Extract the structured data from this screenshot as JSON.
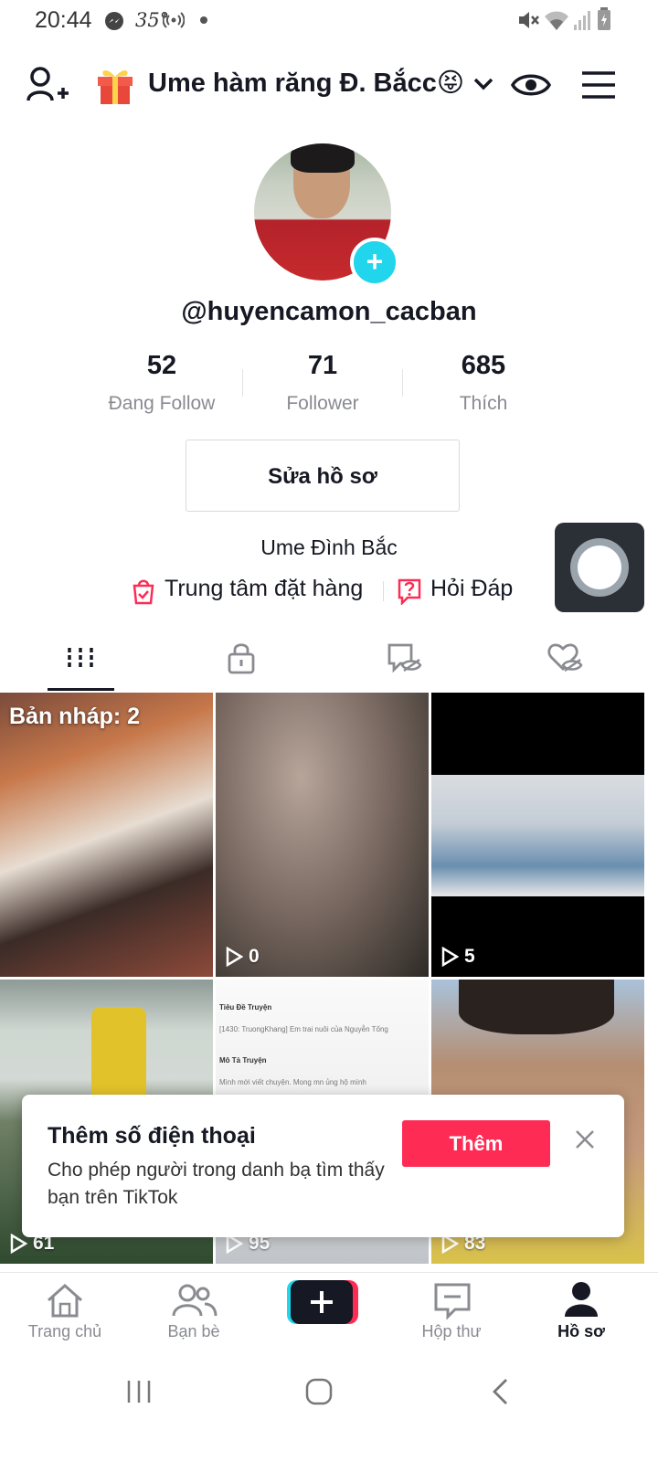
{
  "status_bar": {
    "time": "20:44",
    "temperature": "35°",
    "icons": [
      "messenger-icon",
      "hotspot-icon",
      "dot-icon",
      "mute-icon",
      "wifi-icon",
      "signal-icon",
      "battery-icon"
    ]
  },
  "header": {
    "title": "Ume hàm răng Đ. Bắcc😝",
    "icons": [
      "add-user-icon",
      "gift-icon",
      "chevron-down-icon",
      "eye-icon",
      "menu-icon"
    ]
  },
  "profile": {
    "username": "@huyencamon_cacban",
    "stats": [
      {
        "value": "52",
        "label": "Đang Follow"
      },
      {
        "value": "71",
        "label": "Follower"
      },
      {
        "value": "685",
        "label": "Thích"
      }
    ],
    "edit_button": "Sửa hồ sơ",
    "bio": "Ume Đình Bắc",
    "links": [
      {
        "label": "Trung tâm đặt hàng",
        "icon": "shopping-bag-icon"
      },
      {
        "label": "Hỏi Đáp",
        "icon": "question-box-icon"
      }
    ]
  },
  "tabs": [
    "videos-grid-icon",
    "lock-icon",
    "tag-hidden-icon",
    "heart-hidden-icon"
  ],
  "grid": {
    "draft_label": "Bản nháp: 2",
    "items": [
      {
        "count": ""
      },
      {
        "count": "0"
      },
      {
        "count": "5"
      },
      {
        "count": "61"
      },
      {
        "count": "95"
      },
      {
        "count": "83"
      }
    ],
    "cell5_lines": [
      "Tiêu Đề Truyện",
      "[1430: TruongKhang] Em trai nuôi của Nguyễn Tống",
      "Mô Tả Truyện",
      "Mình mới viết chuyện. Mong mn ủng hộ mình"
    ]
  },
  "popup": {
    "title": "Thêm số điện thoại",
    "description": "Cho phép người trong danh bạ tìm thấy bạn trên TikTok",
    "button": "Thêm"
  },
  "bottom_nav": [
    {
      "label": "Trang chủ",
      "icon": "home-icon"
    },
    {
      "label": "Bạn bè",
      "icon": "friends-icon"
    },
    {
      "label": "",
      "icon": "create-plus-icon"
    },
    {
      "label": "Hộp thư",
      "icon": "inbox-icon"
    },
    {
      "label": "Hồ sơ",
      "icon": "profile-icon"
    }
  ],
  "colors": {
    "accent": "#fe2c55",
    "teal": "#20d5ec",
    "text": "#161823",
    "muted": "#8a8b91"
  }
}
